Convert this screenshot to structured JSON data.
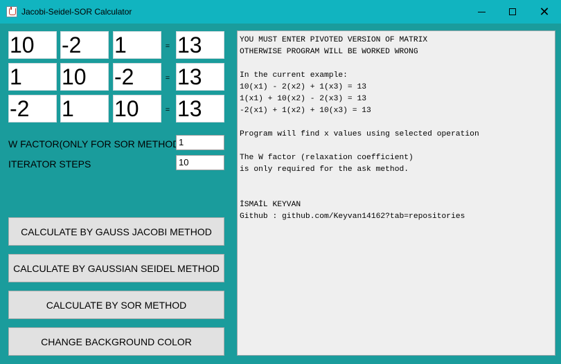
{
  "window": {
    "title": "Jacobi-Seidel-SOR Calculator",
    "close_glyph": "✕"
  },
  "matrix": {
    "rows": [
      {
        "a": [
          "10",
          "-2",
          "1"
        ],
        "eq": "=",
        "b": "13"
      },
      {
        "a": [
          "1",
          "10",
          "-2"
        ],
        "eq": "=",
        "b": "13"
      },
      {
        "a": [
          "-2",
          "1",
          "10"
        ],
        "eq": "=",
        "b": "13"
      }
    ]
  },
  "params": {
    "w_factor_label": "W FACTOR(ONLY FOR SOR METHOD)",
    "w_factor_value": "1",
    "iterator_label": "ITERATOR STEPS",
    "iterator_value": "10"
  },
  "buttons": {
    "jacobi": "CALCULATE BY GAUSS JACOBI METHOD",
    "seidel": "CALCULATE BY GAUSSIAN SEIDEL METHOD",
    "sor": "CALCULATE BY SOR METHOD",
    "bg_color": "CHANGE BACKGROUND COLOR"
  },
  "info": {
    "lines": [
      "YOU MUST ENTER PIVOTED VERSION OF MATRIX",
      "OTHERWISE PROGRAM WILL BE WORKED WRONG",
      "",
      "In the current example:",
      "10(x1) - 2(x2) + 1(x3) = 13",
      "1(x1) + 10(x2) - 2(x3) = 13",
      "-2(x1) + 1(x2) + 10(x3) = 13",
      "",
      "Program will find x values using selected operation",
      "",
      "The W factor (relaxation coefficient)",
      "is only required for the ask method.",
      "",
      "",
      "İSMAİL KEYVAN",
      "Github : github.com/Keyvan14162?tab=repositories"
    ]
  },
  "colors": {
    "background": "#1a9c9c",
    "titlebar": "#11b4c0",
    "button": "#e1e1e1",
    "info_panel": "#efefef"
  }
}
